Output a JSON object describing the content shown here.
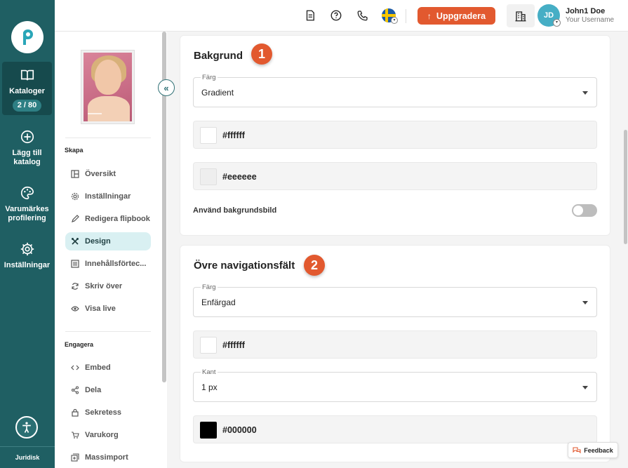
{
  "rail": {
    "items": [
      {
        "label": "Kataloger",
        "badge": "2 / 80",
        "icon": "book-open-icon"
      },
      {
        "label": "Lägg till katalog",
        "icon": "plus-circle-icon"
      },
      {
        "label": "Varumärkes profilering",
        "icon": "palette-icon"
      },
      {
        "label": "Inställningar",
        "icon": "gear-icon"
      }
    ],
    "legal": "Juridisk"
  },
  "topbar": {
    "upgrade_label": "Uppgradera",
    "user_initials": "JD",
    "user_name": "John1 Doe",
    "user_sub": "Your Username"
  },
  "sidebar": {
    "create_heading": "Skapa",
    "create_items": [
      {
        "label": "Översikt",
        "icon": "layout-icon"
      },
      {
        "label": "Inställningar",
        "icon": "gear-icon"
      },
      {
        "label": "Redigera flipbook",
        "icon": "pencil-icon"
      },
      {
        "label": "Design",
        "icon": "tools-icon"
      },
      {
        "label": "Innehållsförtec...",
        "icon": "list-icon"
      },
      {
        "label": "Skriv över",
        "icon": "refresh-icon"
      },
      {
        "label": "Visa live",
        "icon": "eye-icon"
      }
    ],
    "engage_heading": "Engagera",
    "engage_items": [
      {
        "label": "Embed",
        "icon": "code-icon"
      },
      {
        "label": "Dela",
        "icon": "share-icon"
      },
      {
        "label": "Sekretess",
        "icon": "lock-icon"
      },
      {
        "label": "Varukorg",
        "icon": "cart-icon"
      },
      {
        "label": "Massimport",
        "icon": "import-icon"
      }
    ]
  },
  "background": {
    "title": "Bakgrund",
    "step": "1",
    "color_label": "Färg",
    "color_value": "Gradient",
    "color1": "#ffffff",
    "color2": "#eeeeee",
    "use_image_label": "Använd bakgrundsbild"
  },
  "topnav": {
    "title": "Övre navigationsfält",
    "step": "2",
    "color_label": "Färg",
    "color_value": "Enfärgad",
    "color1": "#ffffff",
    "border_label": "Kant",
    "border_value": "1 px",
    "border_color": "#000000"
  },
  "feedback_label": "Feedback",
  "colors": {
    "rail": "#1f5f63",
    "accent": "#e2592f",
    "active_bg": "#d9f0f2"
  }
}
